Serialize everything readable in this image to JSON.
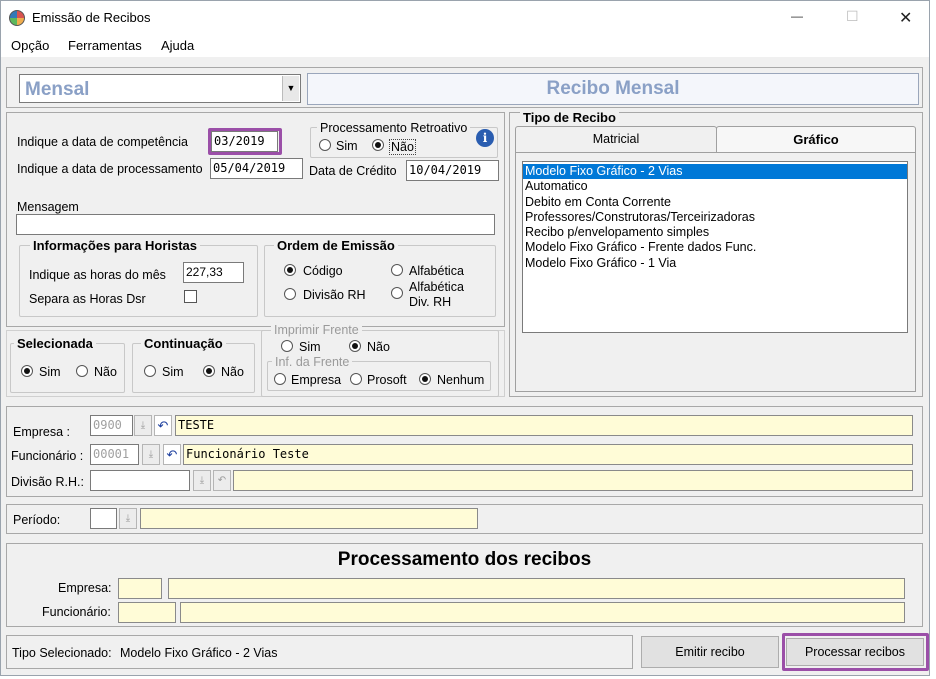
{
  "window": {
    "title": "Emissão de Recibos",
    "controls": {
      "minimize": "—",
      "maximize": "☐",
      "close": "✕"
    }
  },
  "menu": [
    "Opção",
    "Ferramentas",
    "Ajuda"
  ],
  "top": {
    "combo_value": "Mensal",
    "banner": "Recibo Mensal"
  },
  "competencia": {
    "label": "Indique a data de competência",
    "value": "03/2019"
  },
  "processamento": {
    "label": "Indique a data de processamento",
    "value": "05/04/2019"
  },
  "retroativo": {
    "title": "Processamento Retroativo",
    "sim": "Sim",
    "nao": "Não",
    "selected": "nao"
  },
  "credito": {
    "label": "Data de Crédito",
    "value": "10/04/2019"
  },
  "mensagem": {
    "label": "Mensagem",
    "value": ""
  },
  "horistas": {
    "title": "Informações para Horistas",
    "horas_label": "Indique as horas do mês",
    "horas_value": "227,33",
    "dsr_label": "Separa as Horas Dsr",
    "dsr_checked": false
  },
  "ordem": {
    "title": "Ordem de Emissão",
    "codigo": "Código",
    "alfabetica": "Alfabética",
    "divisao": "Divisão RH",
    "alfa_div_1": "Alfabética",
    "alfa_div_2": "Div. RH",
    "selected": "codigo"
  },
  "selecionada": {
    "title": "Selecionada",
    "sim": "Sim",
    "nao": "Não",
    "selected": "sim"
  },
  "continuacao": {
    "title": "Continuação",
    "sim": "Sim",
    "nao": "Não",
    "selected": "nao"
  },
  "imprimir": {
    "title": "Imprimir Frente",
    "sim": "Sim",
    "nao": "Não",
    "selected": "nao",
    "inf_title": "Inf. da Frente",
    "empresa": "Empresa",
    "prosoft": "Prosoft",
    "nenhum": "Nenhum",
    "inf_selected": "nenhum"
  },
  "tipo_recibo": {
    "title": "Tipo de Recibo",
    "tabs": [
      "Matricial",
      "Gráfico"
    ],
    "active_tab": "Gráfico",
    "items": [
      "Modelo Fixo Gráfico - 2 Vias",
      "Automatico",
      "Debito em Conta Corrente",
      "Professores/Construtoras/Terceirizadoras",
      "Recibo p/envelopamento simples",
      "Modelo Fixo Gráfico - Frente dados Func.",
      "Modelo Fixo Gráfico - 1 Via"
    ],
    "selected_index": 0
  },
  "empresa": {
    "label": "Empresa :",
    "code": "0900",
    "name": "TESTE"
  },
  "funcionario": {
    "label": "Funcionário :",
    "code": "00001",
    "name": "Funcionário Teste"
  },
  "divisao": {
    "label": "Divisão R.H.:",
    "code": "",
    "name": ""
  },
  "periodo": {
    "label": "Período:",
    "code": "",
    "value": ""
  },
  "processamento_recibos": {
    "title": "Processamento dos recibos",
    "empresa_label": "Empresa:",
    "funcionario_label": "Funcionário:"
  },
  "status": {
    "label": "Tipo Selecionado:",
    "value": "Modelo Fixo Gráfico - 2 Vias"
  },
  "buttons": {
    "emitir": "Emitir recibo",
    "processar": "Processar recibos"
  },
  "colors": {
    "highlight": "#9b4fa8",
    "selection": "#0078d7",
    "yellow_field": "#fffcd7",
    "banner_text": "#8aa0c6"
  }
}
